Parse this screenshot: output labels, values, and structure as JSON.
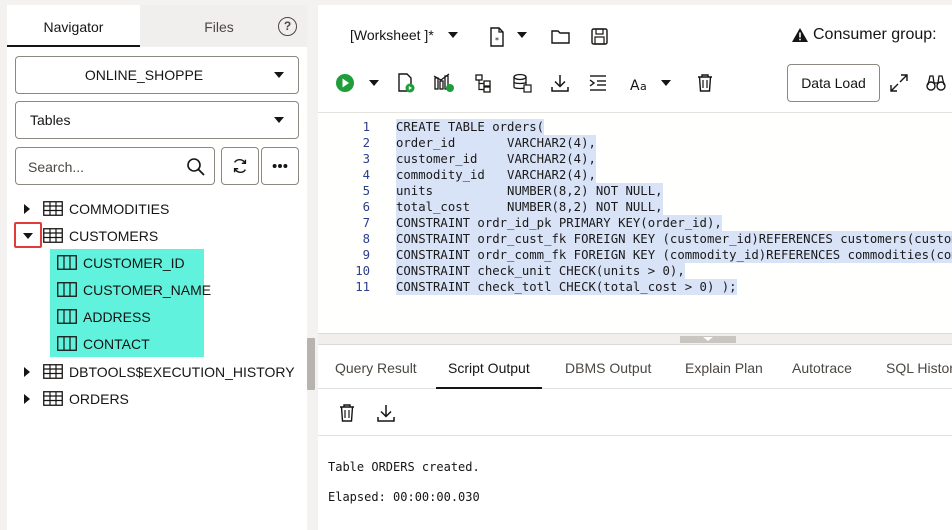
{
  "navigator": {
    "tabs": [
      {
        "label": "Navigator",
        "active": true
      },
      {
        "label": "Files",
        "active": false
      }
    ],
    "help_icon": "question-circle-icon",
    "schema_select": "ONLINE_SHOPPE",
    "object_type_select": "Tables",
    "search_placeholder": "Search...",
    "tree": [
      {
        "label": "COMMODITIES",
        "expanded": false
      },
      {
        "label": "CUSTOMERS",
        "expanded": true,
        "columns": [
          "CUSTOMER_ID",
          "CUSTOMER_NAME",
          "ADDRESS",
          "CONTACT"
        ]
      },
      {
        "label": "DBTOOLS$EXECUTION_HISTORY",
        "expanded": false
      },
      {
        "label": "ORDERS",
        "expanded": false
      }
    ]
  },
  "toolbar": {
    "worksheet_label": "[Worksheet ]*",
    "consumer_group_label": "Consumer group:",
    "data_load_label": "Data Load"
  },
  "editor": {
    "line_numbers": [
      "1",
      "2",
      "3",
      "4",
      "5",
      "6",
      "7",
      "8",
      "9",
      "10",
      "11"
    ],
    "lines": [
      "CREATE TABLE orders(",
      "order_id       VARCHAR2(4),",
      "customer_id    VARCHAR2(4),",
      "commodity_id   VARCHAR2(4),",
      "units          NUMBER(8,2) NOT NULL,",
      "total_cost     NUMBER(8,2) NOT NULL,",
      "CONSTRAINT ordr_id_pk PRIMARY KEY(order_id),",
      "CONSTRAINT ordr_cust_fk FOREIGN KEY (customer_id)REFERENCES customers(customer_id),",
      "CONSTRAINT ordr_comm_fk FOREIGN KEY (commodity_id)REFERENCES commodities(commodity_id),",
      "CONSTRAINT check_unit CHECK(units > 0),",
      "CONSTRAINT check_totl CHECK(total_cost > 0) );"
    ]
  },
  "output_tabs": [
    {
      "label": "Query Result",
      "active": false
    },
    {
      "label": "Script Output",
      "active": true
    },
    {
      "label": "DBMS Output",
      "active": false
    },
    {
      "label": "Explain Plan",
      "active": false
    },
    {
      "label": "Autotrace",
      "active": false
    },
    {
      "label": "SQL History",
      "active": false
    }
  ],
  "output": {
    "lines": [
      "Table ORDERS created.",
      "Elapsed: 00:00:00.030"
    ]
  },
  "colors": {
    "accent_green": "#1e9e3a",
    "column_highlight": "#61f2dd",
    "selection_highlight": "#d8e3f7",
    "expander_box": "#e23b3b"
  }
}
